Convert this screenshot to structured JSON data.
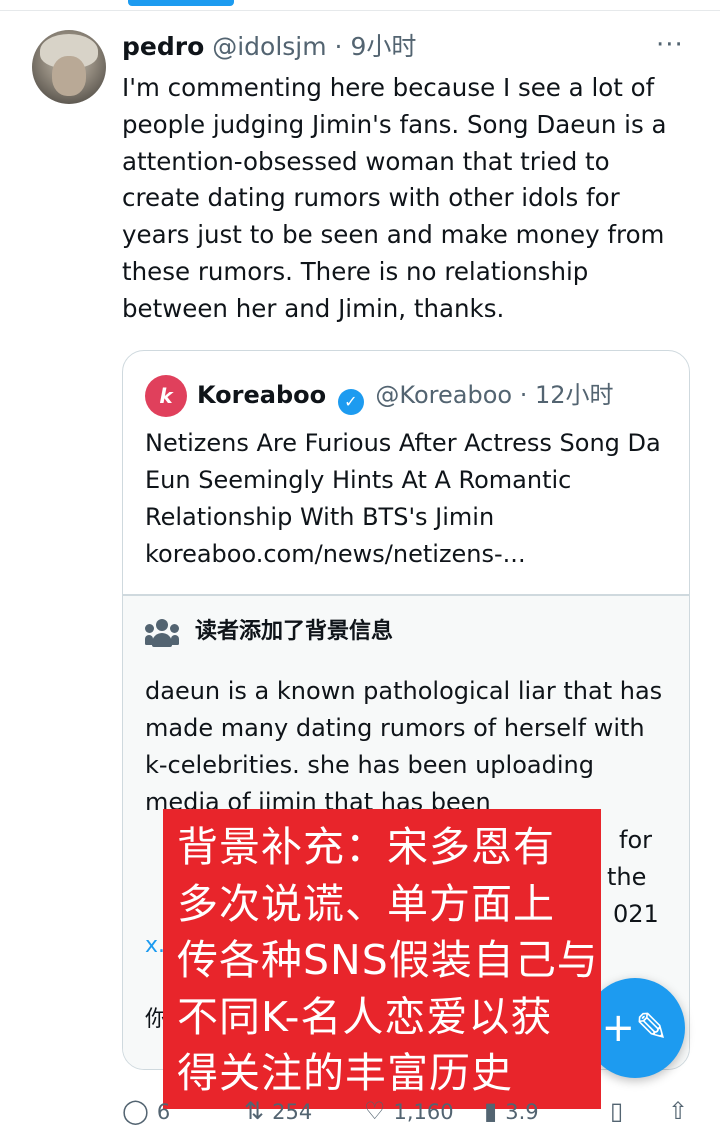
{
  "tweet": {
    "author_name": "pedro",
    "author_handle": "@idolsjm · 9小时",
    "more": "···",
    "text": "I'm commenting here because I see a lot of people judging Jimin's fans. Song Daeun is a attention-obsessed woman that tried to create dating rumors with other idols for years just to be seen and make money from these rumors. There is no relationship between her and Jimin, thanks."
  },
  "quote": {
    "logo_letter": "k",
    "author_name": "Koreaboo",
    "verified_glyph": "✓",
    "author_handle": "@Koreaboo · 12小时",
    "title": "Netizens Are Furious After Actress Song Da Eun Seemingly Hints At A Romantic Relationship With BTS's Jimin",
    "url": "koreaboo.com/news/netizens-..."
  },
  "community_note": {
    "heading": "读者添加了背景信息",
    "text": "daeun is a known pathological liar that has made many dating rumors of herself with k-celebrities. she has been uploading media of jimin that has been",
    "partial_right_1": "for",
    "partial_right_2": "the",
    "partial_right_3": "021",
    "partial_left_link": "x.",
    "partial_foot": "你"
  },
  "overlay": {
    "lines": [
      "背景补充：宋多恩有",
      "多次说谎、单方面上",
      "传各种SNS假装自己与",
      "不同K-名人恋爱以获",
      "得关注的丰富历史"
    ]
  },
  "compose_button": {
    "glyph": "+✎"
  },
  "actions": {
    "reply_count": "6",
    "retweet_count": "254",
    "like_count": "1,160",
    "views_count": "3.9"
  },
  "colors": {
    "accent": "#1d9bf0",
    "overlay_red": "#e8252b",
    "muted": "#536471"
  }
}
